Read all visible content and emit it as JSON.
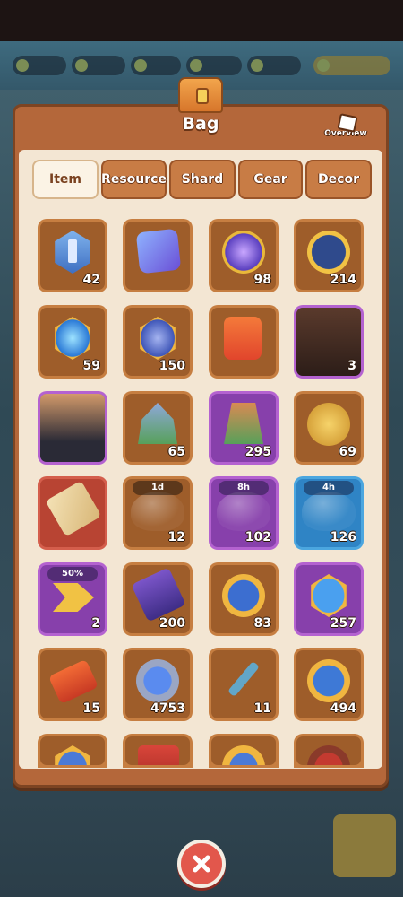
{
  "title": "Bag",
  "overview_label": "Overview",
  "tabs": [
    {
      "label": "Item",
      "active": true
    },
    {
      "label": "Resource",
      "active": false
    },
    {
      "label": "Shard",
      "active": false
    },
    {
      "label": "Gear",
      "active": false
    },
    {
      "label": "Decor",
      "active": false
    }
  ],
  "items": [
    {
      "name": "shield-token-icon",
      "count": "42",
      "rarity": "brown"
    },
    {
      "name": "dice-icon",
      "count": "",
      "rarity": "brown"
    },
    {
      "name": "magic-orb-icon",
      "count": "98",
      "rarity": "brown"
    },
    {
      "name": "gold-emblem-icon",
      "count": "214",
      "rarity": "brown"
    },
    {
      "name": "blue-flame-badge-icon",
      "count": "59",
      "rarity": "brown"
    },
    {
      "name": "checkered-flag-badge-icon",
      "count": "150",
      "rarity": "brown"
    },
    {
      "name": "campfire-upgrade-icon",
      "count": "",
      "rarity": "brown"
    },
    {
      "name": "hero-bear-costume-portrait",
      "count": "3",
      "rarity": "purple"
    },
    {
      "name": "hero-suited-man-portrait",
      "count": "",
      "rarity": "purple"
    },
    {
      "name": "castle-building-icon",
      "count": "65",
      "rarity": "brown"
    },
    {
      "name": "workshop-building-icon",
      "count": "295",
      "rarity": "purple"
    },
    {
      "name": "golden-horn-icon",
      "count": "69",
      "rarity": "brown"
    },
    {
      "name": "scroll-map-icon",
      "count": "",
      "rarity": "red"
    },
    {
      "name": "speedup-bubble-icon",
      "count": "12",
      "rarity": "brown",
      "timer": "1d"
    },
    {
      "name": "speedup-bubble-icon",
      "count": "102",
      "rarity": "purple",
      "timer": "8h"
    },
    {
      "name": "speedup-bubble-icon",
      "count": "126",
      "rarity": "blue",
      "timer": "4h"
    },
    {
      "name": "flag-boost-icon",
      "count": "2",
      "rarity": "purple",
      "timer": "50%"
    },
    {
      "name": "gold-ticket-icon",
      "count": "200",
      "rarity": "brown"
    },
    {
      "name": "crown-medal-icon",
      "count": "83",
      "rarity": "brown"
    },
    {
      "name": "trident-badge-icon",
      "count": "257",
      "rarity": "purple"
    },
    {
      "name": "red-ticket-icon",
      "count": "15",
      "rarity": "brown"
    },
    {
      "name": "blue-gem-icon",
      "count": "4753",
      "rarity": "brown"
    },
    {
      "name": "key-icon",
      "count": "11",
      "rarity": "brown"
    },
    {
      "name": "gold-tree-coin-icon",
      "count": "494",
      "rarity": "brown"
    },
    {
      "name": "partial-badge-icon",
      "count": "",
      "rarity": "brown"
    },
    {
      "name": "partial-ticket-icon",
      "count": "",
      "rarity": "brown"
    },
    {
      "name": "partial-gold-badge-icon",
      "count": "",
      "rarity": "brown"
    },
    {
      "name": "partial-wheel-icon",
      "count": "",
      "rarity": "brown"
    }
  ]
}
